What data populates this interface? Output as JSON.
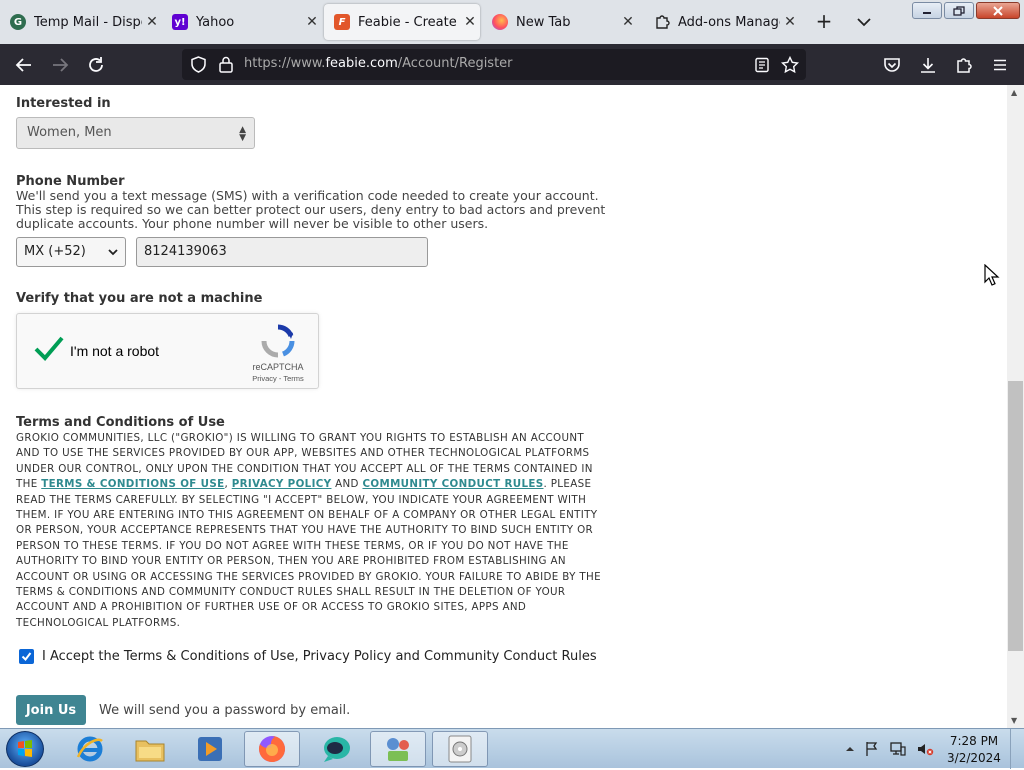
{
  "browser": {
    "tabs": [
      {
        "title": "Temp Mail - Dispos",
        "icon": "tempmail-favicon",
        "active": false
      },
      {
        "title": "Yahoo",
        "icon": "yahoo-favicon",
        "active": false
      },
      {
        "title": "Feabie - Create a N",
        "icon": "feabie-favicon",
        "active": true
      },
      {
        "title": "New Tab",
        "icon": "firefox-favicon",
        "active": false
      },
      {
        "title": "Add-ons Manager",
        "icon": "puzzle-icon",
        "active": false
      }
    ],
    "new_tab_label": "+",
    "url_prefix": "https://www.",
    "url_host": "feabie.com",
    "url_path": "/Account/Register"
  },
  "form": {
    "interested_label": "Interested in",
    "interested_value": "Women, Men",
    "phone_label": "Phone Number",
    "phone_description": "We'll send you a text message (SMS) with a verification code needed to create your account. This step is required so we can better protect our users, deny entry to bad actors and prevent duplicate accounts. Your phone number will never be visible to other users.",
    "country_code": "MX (+52)",
    "phone_value": "8124139063",
    "verify_label": "Verify that you are not a machine",
    "captcha_label": "I'm not a robot",
    "captcha_brand": "reCAPTCHA",
    "captcha_privacy": "Privacy",
    "captcha_sep": " - ",
    "captcha_terms": "Terms",
    "terms_heading": "Terms and Conditions of Use",
    "terms_part1": "GROKIO COMMUNITIES, LLC (\"GROKIO\") IS WILLING TO GRANT YOU RIGHTS TO ESTABLISH AN ACCOUNT AND TO USE THE SERVICES PROVIDED BY OUR APP, WEBSITES AND OTHER TECHNOLOGICAL PLATFORMS UNDER OUR CONTROL, ONLY UPON THE CONDITION THAT YOU ACCEPT ALL OF THE TERMS CONTAINED IN THE ",
    "terms_link1": "TERMS & CONDITIONS OF USE",
    "terms_comma": ", ",
    "terms_link2": "PRIVACY POLICY",
    "terms_and": " AND ",
    "terms_link3": "COMMUNITY CONDUCT RULES",
    "terms_part2": ". PLEASE READ THE TERMS CAREFULLY. BY SELECTING \"I ACCEPT\" BELOW, YOU INDICATE YOUR AGREEMENT WITH THEM. IF YOU ARE ENTERING INTO THIS AGREEMENT ON BEHALF OF A COMPANY OR OTHER LEGAL ENTITY OR PERSON, YOUR ACCEPTANCE REPRESENTS THAT YOU HAVE THE AUTHORITY TO BIND SUCH ENTITY OR PERSON TO THESE TERMS. IF YOU DO NOT AGREE WITH THESE TERMS, OR IF YOU DO NOT HAVE THE AUTHORITY TO BIND YOUR ENTITY OR PERSON, THEN YOU ARE PROHIBITED FROM ESTABLISHING AN ACCOUNT OR USING OR ACCESSING THE SERVICES PROVIDED BY GROKIO. YOUR FAILURE TO ABIDE BY THE TERMS & CONDITIONS AND COMMUNITY CONDUCT RULES SHALL RESULT IN THE DELETION OF YOUR ACCOUNT AND A PROHIBITION OF FURTHER USE OF OR ACCESS TO GROKIO SITES, APPS AND TECHNOLOGICAL PLATFORMS.",
    "accept_label": "I Accept the Terms & Conditions of Use, Privacy Policy and Community Conduct Rules",
    "accept_checked": true,
    "join_button": "Join Us",
    "join_note": "We will send you a password by email."
  },
  "taskbar": {
    "pinned": [
      "internet-explorer-icon",
      "file-explorer-icon",
      "media-player-icon",
      "firefox-icon",
      "chat-app-icon",
      "control-panel-icon",
      "disc-app-icon"
    ],
    "clock_time": "7:28 PM",
    "clock_date": "3/2/2024"
  },
  "colors": {
    "accent": "#3f8592",
    "link": "#2f8a8f",
    "checkbox": "#0b66d6",
    "browser_toolbar": "#2b2a33"
  }
}
